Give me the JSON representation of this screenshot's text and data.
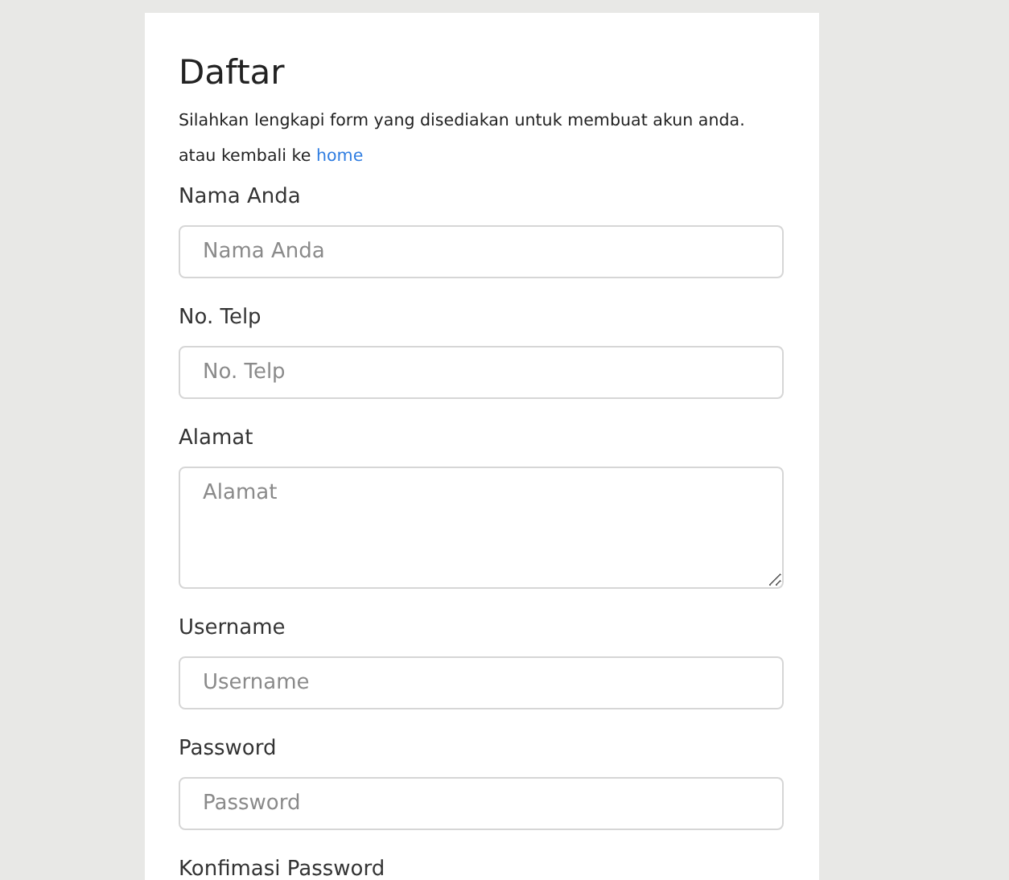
{
  "title": "Daftar",
  "intro": {
    "text": "Silahkan lengkapi form yang disediakan untuk membuat akun anda. atau kembali ke",
    "link": "home"
  },
  "fields": [
    {
      "kind": "input",
      "label": "Nama Anda",
      "placeholder": "Nama Anda"
    },
    {
      "kind": "input",
      "label": "No. Telp",
      "placeholder": "No. Telp"
    },
    {
      "kind": "textarea",
      "label": "Alamat",
      "placeholder": "Alamat"
    },
    {
      "kind": "input",
      "label": "Username",
      "placeholder": "Username"
    },
    {
      "kind": "input",
      "label": "Password",
      "placeholder": "Password"
    },
    {
      "kind": "label",
      "label": "Konfimasi Password"
    }
  ]
}
